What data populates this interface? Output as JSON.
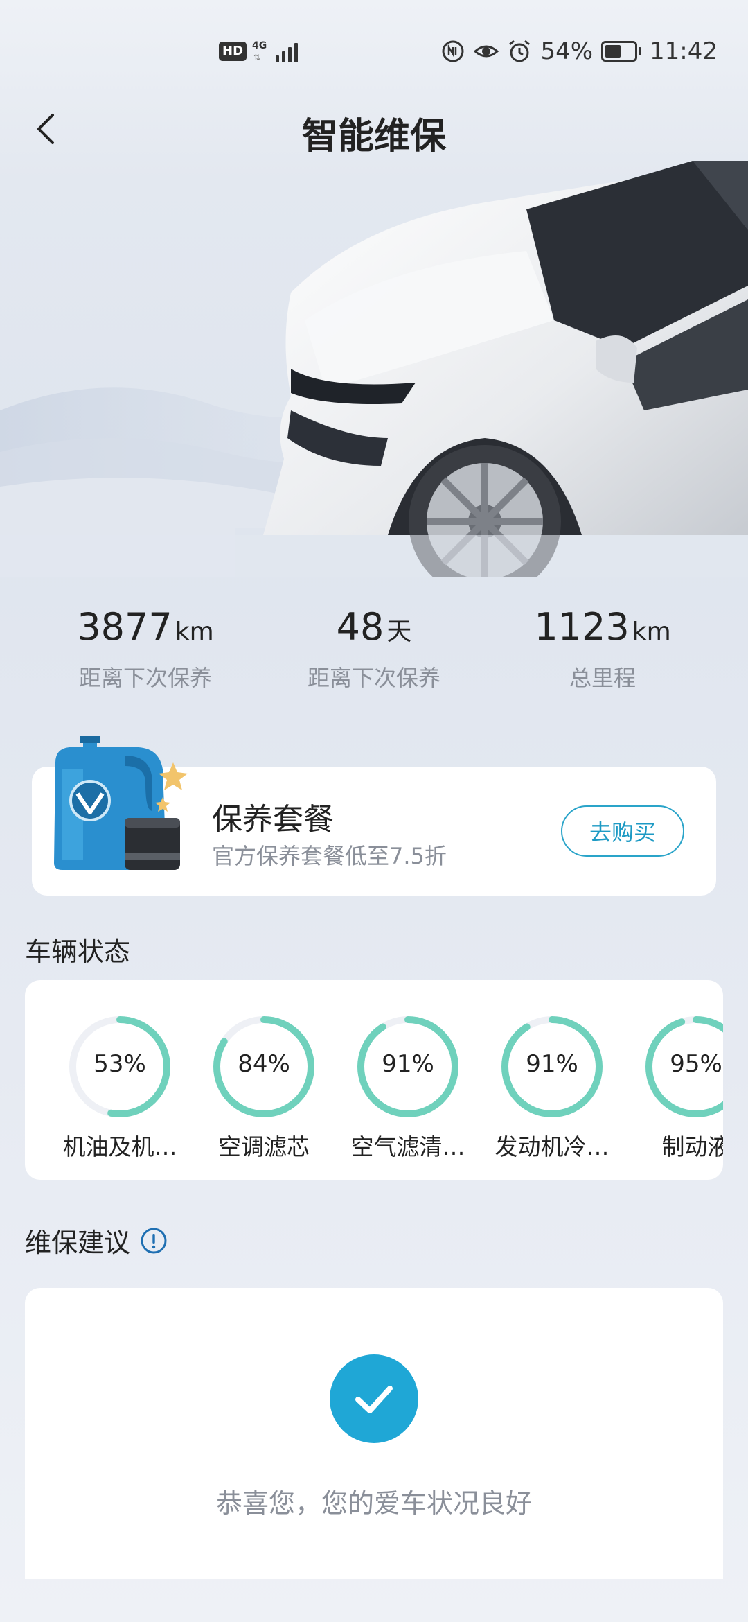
{
  "status_bar": {
    "hd": "HD",
    "network": "4G",
    "battery": "54%",
    "time": "11:42",
    "battery_level": 0.54
  },
  "header": {
    "title": "智能维保"
  },
  "stats": [
    {
      "value": "3877",
      "unit": "km",
      "label": "距离下次保养"
    },
    {
      "value": "48",
      "unit": "天",
      "label": "距离下次保养"
    },
    {
      "value": "1123",
      "unit": "km",
      "label": "总里程"
    }
  ],
  "package": {
    "title": "保养套餐",
    "subtitle": "官方保养套餐低至7.5折",
    "button": "去购买"
  },
  "vehicle_status": {
    "title": "车辆状态",
    "items": [
      {
        "value": "53%",
        "percent": 53,
        "label": "机油及机…"
      },
      {
        "value": "84%",
        "percent": 84,
        "label": "空调滤芯"
      },
      {
        "value": "91%",
        "percent": 91,
        "label": "空气滤清…"
      },
      {
        "value": "91%",
        "percent": 91,
        "label": "发动机冷…"
      },
      {
        "value": "95%",
        "percent": 95,
        "label": "制动液"
      }
    ]
  },
  "advice": {
    "title": "维保建议",
    "message": "恭喜您，您的爱车状况良好"
  },
  "colors": {
    "accent": "#1fa7d6",
    "gauge": "#6fd1bc",
    "gauge_track": "#eef0f5"
  }
}
